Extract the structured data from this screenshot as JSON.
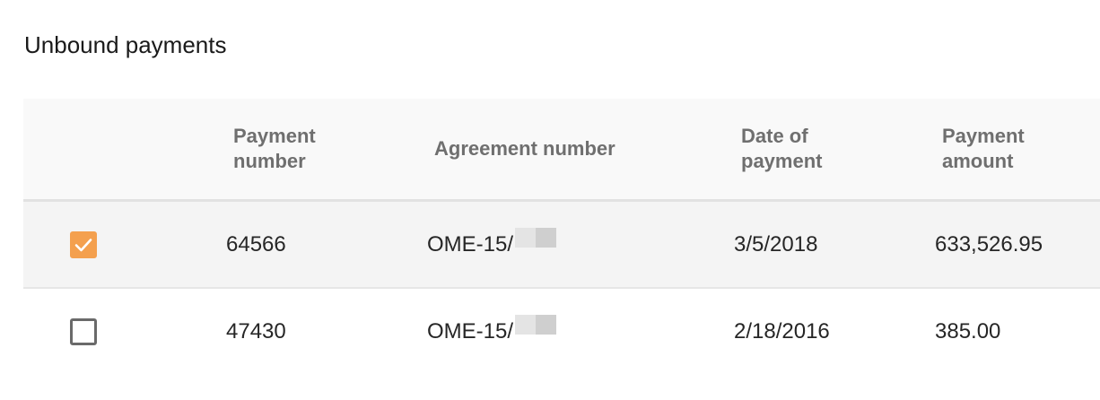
{
  "section": {
    "title": "Unbound payments"
  },
  "table": {
    "headers": {
      "payment_number_line1": "Payment",
      "payment_number_line2": "number",
      "agreement_number": "Agreement number",
      "date_line1": "Date of",
      "date_line2": "payment",
      "amount_line1": "Payment",
      "amount_line2": "amount"
    },
    "rows": [
      {
        "checked": true,
        "payment_number": "64566",
        "agreement_number": "OME-15/",
        "date": "3/5/2018",
        "amount": "633,526.95"
      },
      {
        "checked": false,
        "payment_number": "47430",
        "agreement_number": "OME-15/",
        "date": "2/18/2016",
        "amount": "385.00"
      }
    ]
  },
  "colors": {
    "checkbox_checked": "#f4a04e",
    "selected_row_bg": "#f4f4f4",
    "header_bg": "#f9f9f9"
  }
}
